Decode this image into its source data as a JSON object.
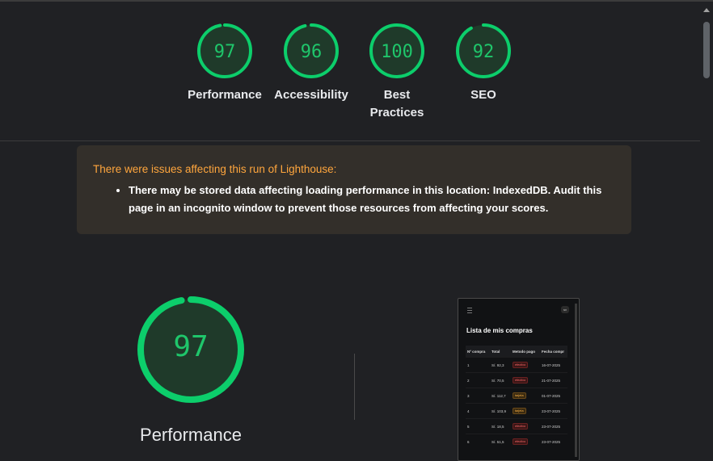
{
  "scores": [
    {
      "value": 97,
      "label": "Performance",
      "fraction": 0.97
    },
    {
      "value": 96,
      "label": "Accessibility",
      "fraction": 0.96
    },
    {
      "value": 100,
      "label": "Best Practices",
      "fraction": 1.0
    },
    {
      "value": 92,
      "label": "SEO",
      "fraction": 0.92
    }
  ],
  "warning": {
    "title": "There were issues affecting this run of Lighthouse:",
    "items": [
      "There may be stored data affecting loading performance in this location: IndexedDB. Audit this page in an incognito window to prevent those resources from affecting your scores."
    ]
  },
  "main_score": {
    "value": 97,
    "label": "Performance",
    "fraction": 0.97
  },
  "screenshot": {
    "avatar": "sv",
    "title": "Lista de mis compras",
    "columns": [
      "Nº compra",
      "Total",
      "Metodo pago",
      "Fecha compr"
    ],
    "rows": [
      {
        "n": "1",
        "total": "S/. 92,3",
        "metodo": "efectivo",
        "fecha": "16-07-2025"
      },
      {
        "n": "2",
        "total": "S/. 70,5",
        "metodo": "efectivo",
        "fecha": "21-07-2025"
      },
      {
        "n": "3",
        "total": "S/. 112,7",
        "metodo": "tarjeta",
        "fecha": "01-07-2025"
      },
      {
        "n": "4",
        "total": "S/. 103,9",
        "metodo": "tarjeta",
        "fecha": "23-07-2025"
      },
      {
        "n": "5",
        "total": "S/. 18,5",
        "metodo": "efectivo",
        "fecha": "23-07-2025"
      },
      {
        "n": "6",
        "total": "S/. 51,5",
        "metodo": "efectivo",
        "fecha": "23-07-2025"
      }
    ]
  },
  "colors": {
    "pass": "#0cce6b",
    "pass_fill": "#1f3a2a",
    "background": "#202124",
    "warning_bg": "#332f2a",
    "warning_title": "#ffa63d"
  }
}
